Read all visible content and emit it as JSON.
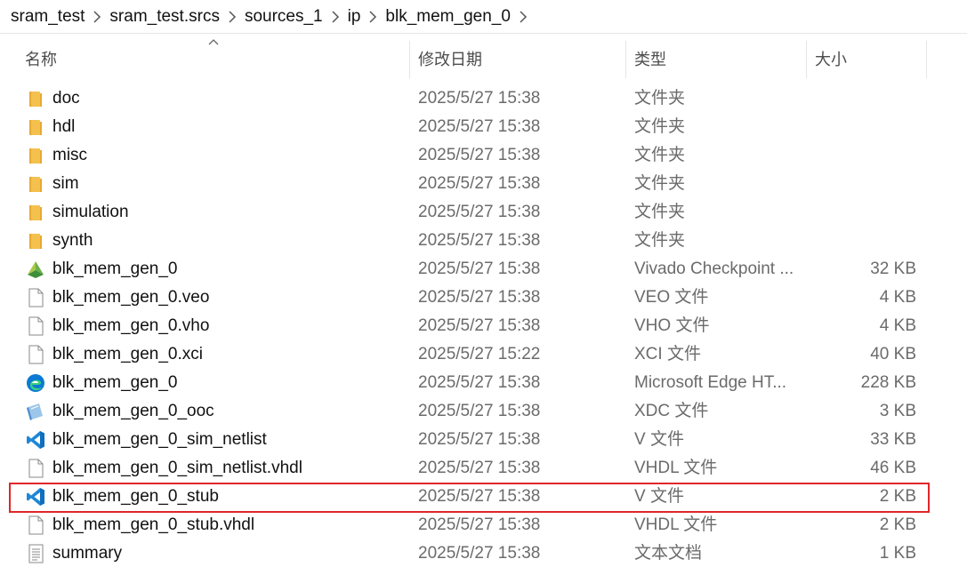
{
  "breadcrumb": [
    "sram_test",
    "sram_test.srcs",
    "sources_1",
    "ip",
    "blk_mem_gen_0"
  ],
  "columns": {
    "name": "名称",
    "date": "修改日期",
    "type": "类型",
    "size": "大小"
  },
  "files": [
    {
      "name": "doc",
      "date": "2025/5/27 15:38",
      "type": "文件夹",
      "size": "",
      "icon": "folder-icon"
    },
    {
      "name": "hdl",
      "date": "2025/5/27 15:38",
      "type": "文件夹",
      "size": "",
      "icon": "folder-icon"
    },
    {
      "name": "misc",
      "date": "2025/5/27 15:38",
      "type": "文件夹",
      "size": "",
      "icon": "folder-icon"
    },
    {
      "name": "sim",
      "date": "2025/5/27 15:38",
      "type": "文件夹",
      "size": "",
      "icon": "folder-icon"
    },
    {
      "name": "simulation",
      "date": "2025/5/27 15:38",
      "type": "文件夹",
      "size": "",
      "icon": "folder-icon"
    },
    {
      "name": "synth",
      "date": "2025/5/27 15:38",
      "type": "文件夹",
      "size": "",
      "icon": "folder-icon"
    },
    {
      "name": "blk_mem_gen_0",
      "date": "2025/5/27 15:38",
      "type": "Vivado Checkpoint ...",
      "size": "32 KB",
      "icon": "vivado-icon"
    },
    {
      "name": "blk_mem_gen_0.veo",
      "date": "2025/5/27 15:38",
      "type": "VEO 文件",
      "size": "4 KB",
      "icon": "file-icon"
    },
    {
      "name": "blk_mem_gen_0.vho",
      "date": "2025/5/27 15:38",
      "type": "VHO 文件",
      "size": "4 KB",
      "icon": "file-icon"
    },
    {
      "name": "blk_mem_gen_0.xci",
      "date": "2025/5/27 15:22",
      "type": "XCI 文件",
      "size": "40 KB",
      "icon": "file-icon"
    },
    {
      "name": "blk_mem_gen_0",
      "date": "2025/5/27 15:38",
      "type": "Microsoft Edge HT...",
      "size": "228 KB",
      "icon": "edge-icon"
    },
    {
      "name": "blk_mem_gen_0_ooc",
      "date": "2025/5/27 15:38",
      "type": "XDC 文件",
      "size": "3 KB",
      "icon": "xdc-icon"
    },
    {
      "name": "blk_mem_gen_0_sim_netlist",
      "date": "2025/5/27 15:38",
      "type": "V 文件",
      "size": "33 KB",
      "icon": "vscode-icon"
    },
    {
      "name": "blk_mem_gen_0_sim_netlist.vhdl",
      "date": "2025/5/27 15:38",
      "type": "VHDL 文件",
      "size": "46 KB",
      "icon": "file-icon"
    },
    {
      "name": "blk_mem_gen_0_stub",
      "date": "2025/5/27 15:38",
      "type": "V 文件",
      "size": "2 KB",
      "icon": "vscode-icon",
      "highlighted": true
    },
    {
      "name": "blk_mem_gen_0_stub.vhdl",
      "date": "2025/5/27 15:38",
      "type": "VHDL 文件",
      "size": "2 KB",
      "icon": "file-icon"
    },
    {
      "name": "summary",
      "date": "2025/5/27 15:38",
      "type": "文本文档",
      "size": "1 KB",
      "icon": "text-doc-icon"
    }
  ],
  "colors": {
    "highlight": "#e0262a",
    "folder": "#f4c04e",
    "vscode": "#1f87d6",
    "edge": "#0c7ad4"
  }
}
